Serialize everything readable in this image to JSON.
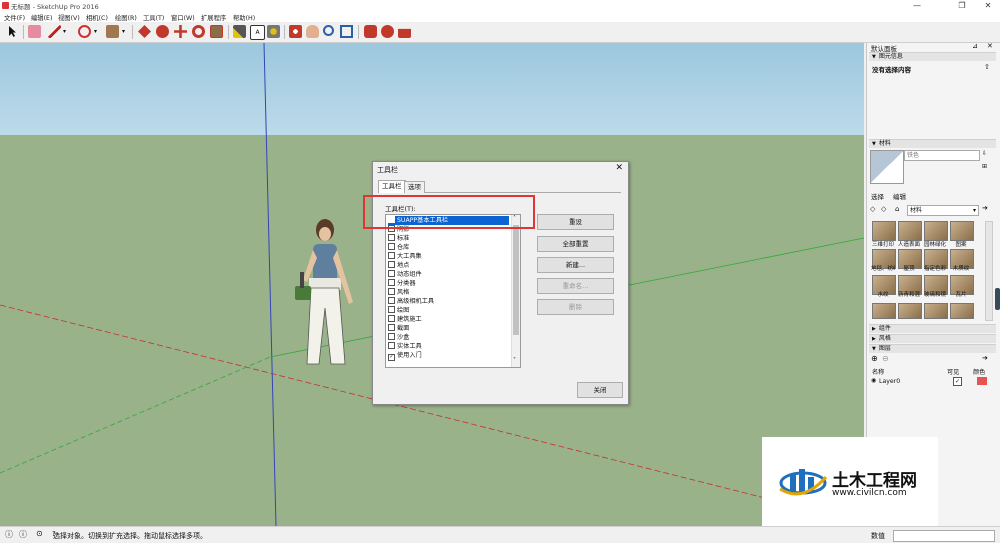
{
  "window": {
    "title": "无标题 - SketchUp Pro 2016",
    "minimize": "—",
    "maximize": "❐",
    "close": "✕"
  },
  "menubar": [
    "文件(F)",
    "编辑(E)",
    "视图(V)",
    "相机(C)",
    "绘图(R)",
    "工具(T)",
    "窗口(W)",
    "扩展程序",
    "帮助(H)"
  ],
  "tray": {
    "title": "默认面板",
    "entity_info": {
      "header": "图元信息",
      "content": "没有选择内容"
    },
    "materials": {
      "header": "材料",
      "name_placeholder": "铁色",
      "tabs": [
        "选择",
        "编辑"
      ],
      "library": "材料",
      "swatches": [
        "三维打印",
        "人造表面",
        "园林绿化",
        "图案",
        "地毯、纺织",
        "屋顶",
        "指定色彩",
        "木质纹",
        "水纹",
        "沥青和混",
        "玻璃和镜",
        "瓦片"
      ]
    },
    "sections": [
      "组件",
      "风格",
      "图层"
    ],
    "layers": {
      "col_name": "名称",
      "col_visible": "可见",
      "col_color": "颜色",
      "row_name": "Layer0",
      "row_visible": "✓",
      "row_color": "#e55353"
    }
  },
  "dialog": {
    "title": "工具栏",
    "close": "✕",
    "tabs": [
      "工具栏",
      "选项"
    ],
    "list_label": "工具栏(T):",
    "items": [
      {
        "label": "SUAPP基本工具栏",
        "checked": false,
        "selected": true
      },
      {
        "label": "阴影",
        "checked": false
      },
      {
        "label": "标准",
        "checked": false
      },
      {
        "label": "仓库",
        "checked": false
      },
      {
        "label": "大工具集",
        "checked": false
      },
      {
        "label": "地点",
        "checked": false
      },
      {
        "label": "动态组件",
        "checked": false
      },
      {
        "label": "分类器",
        "checked": false
      },
      {
        "label": "风格",
        "checked": false
      },
      {
        "label": "高级相机工具",
        "checked": false
      },
      {
        "label": "绘图",
        "checked": false
      },
      {
        "label": "建筑施工",
        "checked": false
      },
      {
        "label": "截面",
        "checked": false
      },
      {
        "label": "沙盒",
        "checked": false
      },
      {
        "label": "实体工具",
        "checked": false
      },
      {
        "label": "使用入门",
        "checked": true
      }
    ],
    "buttons": {
      "reset": "重设",
      "reset_all": "全部重置",
      "new": "新建...",
      "rename": "重命名...",
      "delete": "删除",
      "close": "关闭"
    }
  },
  "status": {
    "text": "选择对象。切换到扩充选择。拖动鼠标选择多项。",
    "measure_label": "数值"
  },
  "watermark": {
    "name": "土木工程网",
    "url": "www.civilcn.com"
  },
  "colors": {
    "sky": "#9cc7dd",
    "ground": "#9ab28a",
    "selection": "#0a64d2",
    "highlight_box": "#e03535"
  }
}
